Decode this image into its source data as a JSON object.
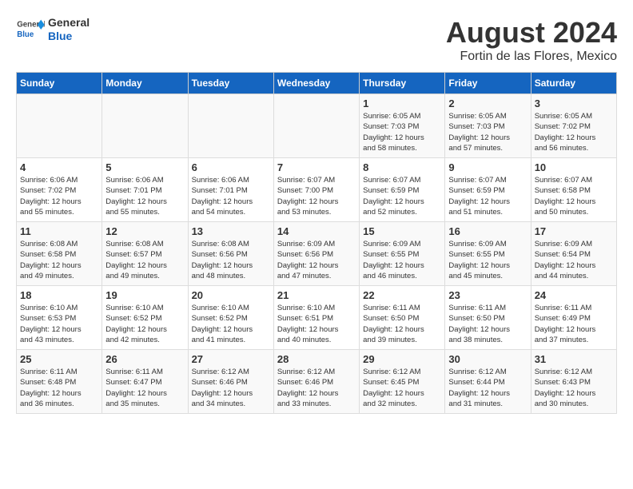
{
  "header": {
    "logo_line1": "General",
    "logo_line2": "Blue",
    "title": "August 2024",
    "subtitle": "Fortin de las Flores, Mexico"
  },
  "days_of_week": [
    "Sunday",
    "Monday",
    "Tuesday",
    "Wednesday",
    "Thursday",
    "Friday",
    "Saturday"
  ],
  "weeks": [
    [
      {
        "day": "",
        "info": ""
      },
      {
        "day": "",
        "info": ""
      },
      {
        "day": "",
        "info": ""
      },
      {
        "day": "",
        "info": ""
      },
      {
        "day": "1",
        "info": "Sunrise: 6:05 AM\nSunset: 7:03 PM\nDaylight: 12 hours\nand 58 minutes."
      },
      {
        "day": "2",
        "info": "Sunrise: 6:05 AM\nSunset: 7:03 PM\nDaylight: 12 hours\nand 57 minutes."
      },
      {
        "day": "3",
        "info": "Sunrise: 6:05 AM\nSunset: 7:02 PM\nDaylight: 12 hours\nand 56 minutes."
      }
    ],
    [
      {
        "day": "4",
        "info": "Sunrise: 6:06 AM\nSunset: 7:02 PM\nDaylight: 12 hours\nand 55 minutes."
      },
      {
        "day": "5",
        "info": "Sunrise: 6:06 AM\nSunset: 7:01 PM\nDaylight: 12 hours\nand 55 minutes."
      },
      {
        "day": "6",
        "info": "Sunrise: 6:06 AM\nSunset: 7:01 PM\nDaylight: 12 hours\nand 54 minutes."
      },
      {
        "day": "7",
        "info": "Sunrise: 6:07 AM\nSunset: 7:00 PM\nDaylight: 12 hours\nand 53 minutes."
      },
      {
        "day": "8",
        "info": "Sunrise: 6:07 AM\nSunset: 6:59 PM\nDaylight: 12 hours\nand 52 minutes."
      },
      {
        "day": "9",
        "info": "Sunrise: 6:07 AM\nSunset: 6:59 PM\nDaylight: 12 hours\nand 51 minutes."
      },
      {
        "day": "10",
        "info": "Sunrise: 6:07 AM\nSunset: 6:58 PM\nDaylight: 12 hours\nand 50 minutes."
      }
    ],
    [
      {
        "day": "11",
        "info": "Sunrise: 6:08 AM\nSunset: 6:58 PM\nDaylight: 12 hours\nand 49 minutes."
      },
      {
        "day": "12",
        "info": "Sunrise: 6:08 AM\nSunset: 6:57 PM\nDaylight: 12 hours\nand 49 minutes."
      },
      {
        "day": "13",
        "info": "Sunrise: 6:08 AM\nSunset: 6:56 PM\nDaylight: 12 hours\nand 48 minutes."
      },
      {
        "day": "14",
        "info": "Sunrise: 6:09 AM\nSunset: 6:56 PM\nDaylight: 12 hours\nand 47 minutes."
      },
      {
        "day": "15",
        "info": "Sunrise: 6:09 AM\nSunset: 6:55 PM\nDaylight: 12 hours\nand 46 minutes."
      },
      {
        "day": "16",
        "info": "Sunrise: 6:09 AM\nSunset: 6:55 PM\nDaylight: 12 hours\nand 45 minutes."
      },
      {
        "day": "17",
        "info": "Sunrise: 6:09 AM\nSunset: 6:54 PM\nDaylight: 12 hours\nand 44 minutes."
      }
    ],
    [
      {
        "day": "18",
        "info": "Sunrise: 6:10 AM\nSunset: 6:53 PM\nDaylight: 12 hours\nand 43 minutes."
      },
      {
        "day": "19",
        "info": "Sunrise: 6:10 AM\nSunset: 6:52 PM\nDaylight: 12 hours\nand 42 minutes."
      },
      {
        "day": "20",
        "info": "Sunrise: 6:10 AM\nSunset: 6:52 PM\nDaylight: 12 hours\nand 41 minutes."
      },
      {
        "day": "21",
        "info": "Sunrise: 6:10 AM\nSunset: 6:51 PM\nDaylight: 12 hours\nand 40 minutes."
      },
      {
        "day": "22",
        "info": "Sunrise: 6:11 AM\nSunset: 6:50 PM\nDaylight: 12 hours\nand 39 minutes."
      },
      {
        "day": "23",
        "info": "Sunrise: 6:11 AM\nSunset: 6:50 PM\nDaylight: 12 hours\nand 38 minutes."
      },
      {
        "day": "24",
        "info": "Sunrise: 6:11 AM\nSunset: 6:49 PM\nDaylight: 12 hours\nand 37 minutes."
      }
    ],
    [
      {
        "day": "25",
        "info": "Sunrise: 6:11 AM\nSunset: 6:48 PM\nDaylight: 12 hours\nand 36 minutes."
      },
      {
        "day": "26",
        "info": "Sunrise: 6:11 AM\nSunset: 6:47 PM\nDaylight: 12 hours\nand 35 minutes."
      },
      {
        "day": "27",
        "info": "Sunrise: 6:12 AM\nSunset: 6:46 PM\nDaylight: 12 hours\nand 34 minutes."
      },
      {
        "day": "28",
        "info": "Sunrise: 6:12 AM\nSunset: 6:46 PM\nDaylight: 12 hours\nand 33 minutes."
      },
      {
        "day": "29",
        "info": "Sunrise: 6:12 AM\nSunset: 6:45 PM\nDaylight: 12 hours\nand 32 minutes."
      },
      {
        "day": "30",
        "info": "Sunrise: 6:12 AM\nSunset: 6:44 PM\nDaylight: 12 hours\nand 31 minutes."
      },
      {
        "day": "31",
        "info": "Sunrise: 6:12 AM\nSunset: 6:43 PM\nDaylight: 12 hours\nand 30 minutes."
      }
    ]
  ]
}
